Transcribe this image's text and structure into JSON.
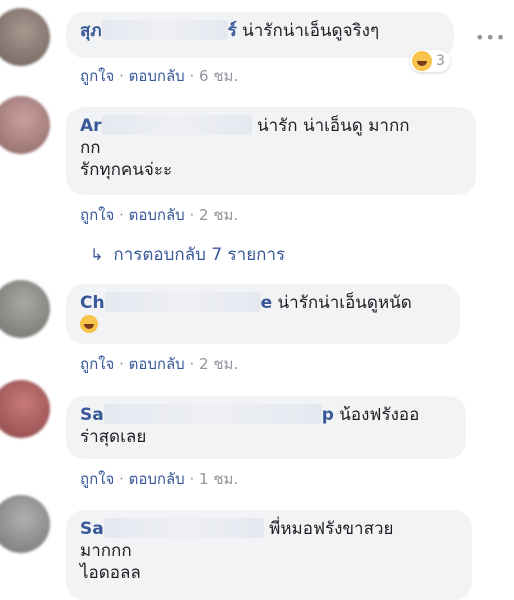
{
  "comments": [
    {
      "name": "สุภ",
      "name_tail": "ร์",
      "text": "น่ารักน่าเอ็นดูจริงๆ",
      "like_label": "ถูกใจ",
      "reply_label": "ตอบกลับ",
      "time": "6 ชม.",
      "reaction_count": "3",
      "reaction_icon": "haha-emoji-icon"
    },
    {
      "name": "Ar",
      "text_line1": "น่ารัก น่าเอ็นดู มากก",
      "text_line2": "กก",
      "text_line3": "รักทุกคนจ่ะะ",
      "like_label": "ถูกใจ",
      "reply_label": "ตอบกลับ",
      "time": "2 ชม."
    },
    {
      "name": "Ch",
      "name_tail": "e",
      "text": "น่ารักน่าเอ็นดูหนัด",
      "emoji": "rofl-emoji-icon",
      "like_label": "ถูกใจ",
      "reply_label": "ตอบกลับ",
      "time": "2 ชม."
    },
    {
      "name": "Sa",
      "name_tail": "p",
      "text_line1": "น้องฟรังออ",
      "text_line2": "ร่าสุดเลย",
      "like_label": "ถูกใจ",
      "reply_label": "ตอบกลับ",
      "time": "1 ชม."
    },
    {
      "name": "Sa",
      "text_line1": "พี่หมอฟรังขาสวย",
      "text_line2": "มากกก",
      "text_line3": "ไอดอลล"
    }
  ],
  "replies_link": {
    "label": "การตอบกลับ 7 รายการ",
    "icon": "reply-arrow-icon"
  },
  "separator": "·",
  "more_icon": "more-options-icon",
  "colors": {
    "link": "#385898",
    "bubble": "#f2f3f5",
    "meta": "#90949c"
  }
}
